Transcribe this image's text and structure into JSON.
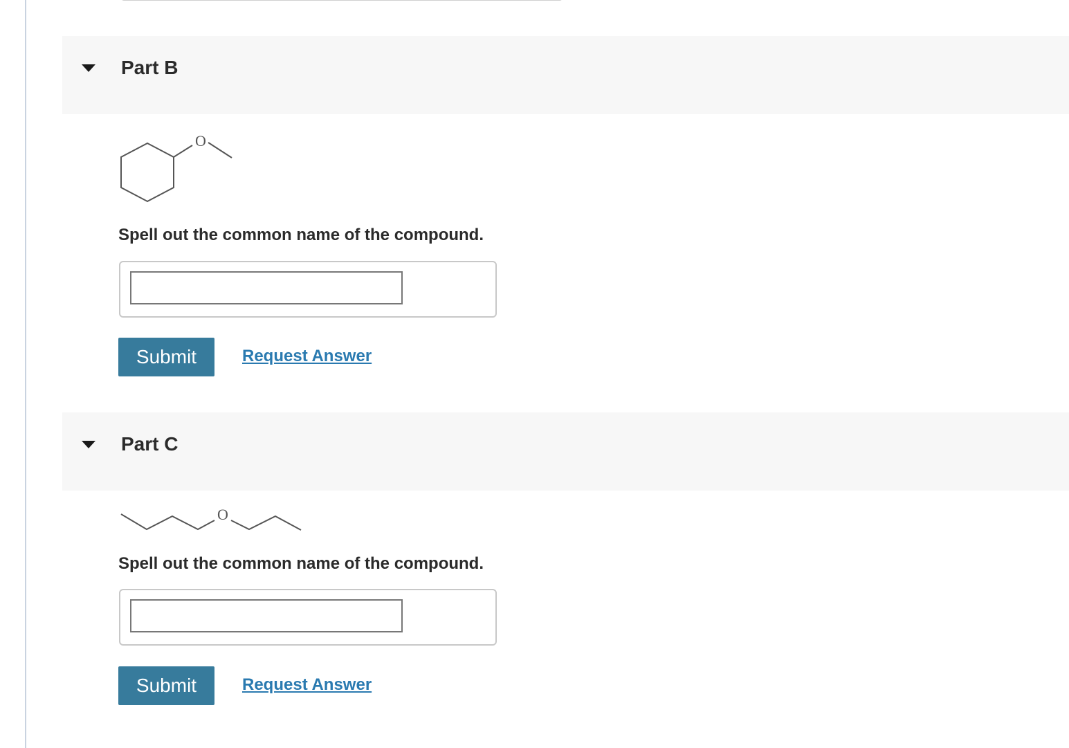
{
  "parts": [
    {
      "id": "B",
      "title": "Part B",
      "molecule_icon": "cyclohexyl-methyl-ether-structure",
      "oxygen_label": "O",
      "question": "Spell out the common name of the compound.",
      "answer_value": "",
      "submit_label": "Submit",
      "request_label": "Request Answer"
    },
    {
      "id": "C",
      "title": "Part C",
      "molecule_icon": "butyl-propyl-ether-structure",
      "oxygen_label": "O",
      "question": "Spell out the common name of the compound.",
      "answer_value": "",
      "submit_label": "Submit",
      "request_label": "Request Answer"
    }
  ],
  "colors": {
    "header_bg": "#f7f7f7",
    "submit_bg": "#377b9c",
    "link": "#2a7ab0"
  }
}
